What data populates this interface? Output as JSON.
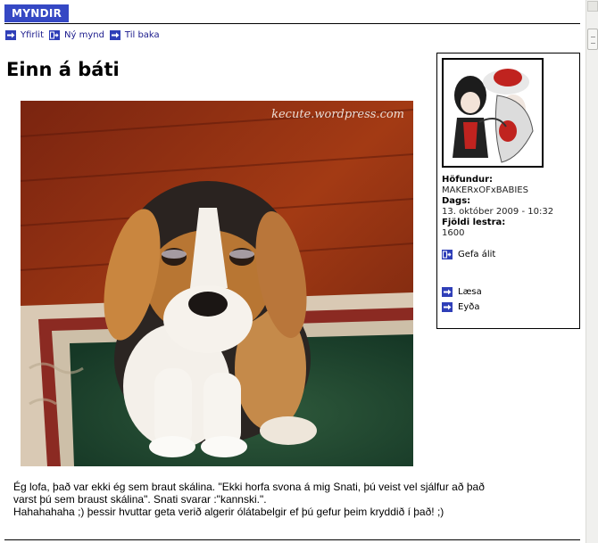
{
  "header": {
    "title": "MYNDIR"
  },
  "nav": [
    {
      "label": "Yfirlit",
      "icon": "arrow-right-icon"
    },
    {
      "label": "Ný mynd",
      "icon": "new-image-icon"
    },
    {
      "label": "Til baka",
      "icon": "arrow-right-icon"
    }
  ],
  "post": {
    "title": "Einn á báti",
    "watermark": "kecute.wordpress.com",
    "description_line1": "Ég lofa, það var ekki ég sem braut skálina. \"Ekki horfa svona á mig Snati, þú veist vel sjálfur að það",
    "description_line2": "varst þú sem braust skálina\". Snati svarar :\"kannski.\".",
    "description_line3": "Hahahahaha ;) þessir hvuttar geta verið algerir ólátabelgir ef þú gefur þeim kryddið í það! ;)"
  },
  "info": {
    "author_label": "Höfundur:",
    "author": "MAKERxOFxBABIES",
    "date_label": "Dags:",
    "date": "13. október 2009 - 10:32",
    "views_label": "Fjöldi lestra:",
    "views": "1600",
    "comment_label": "Gefa álit",
    "read_label": "Læsa",
    "delete_label": "Eyða"
  },
  "colors": {
    "accent": "#3548c4",
    "icon": "#2f3fb8"
  }
}
